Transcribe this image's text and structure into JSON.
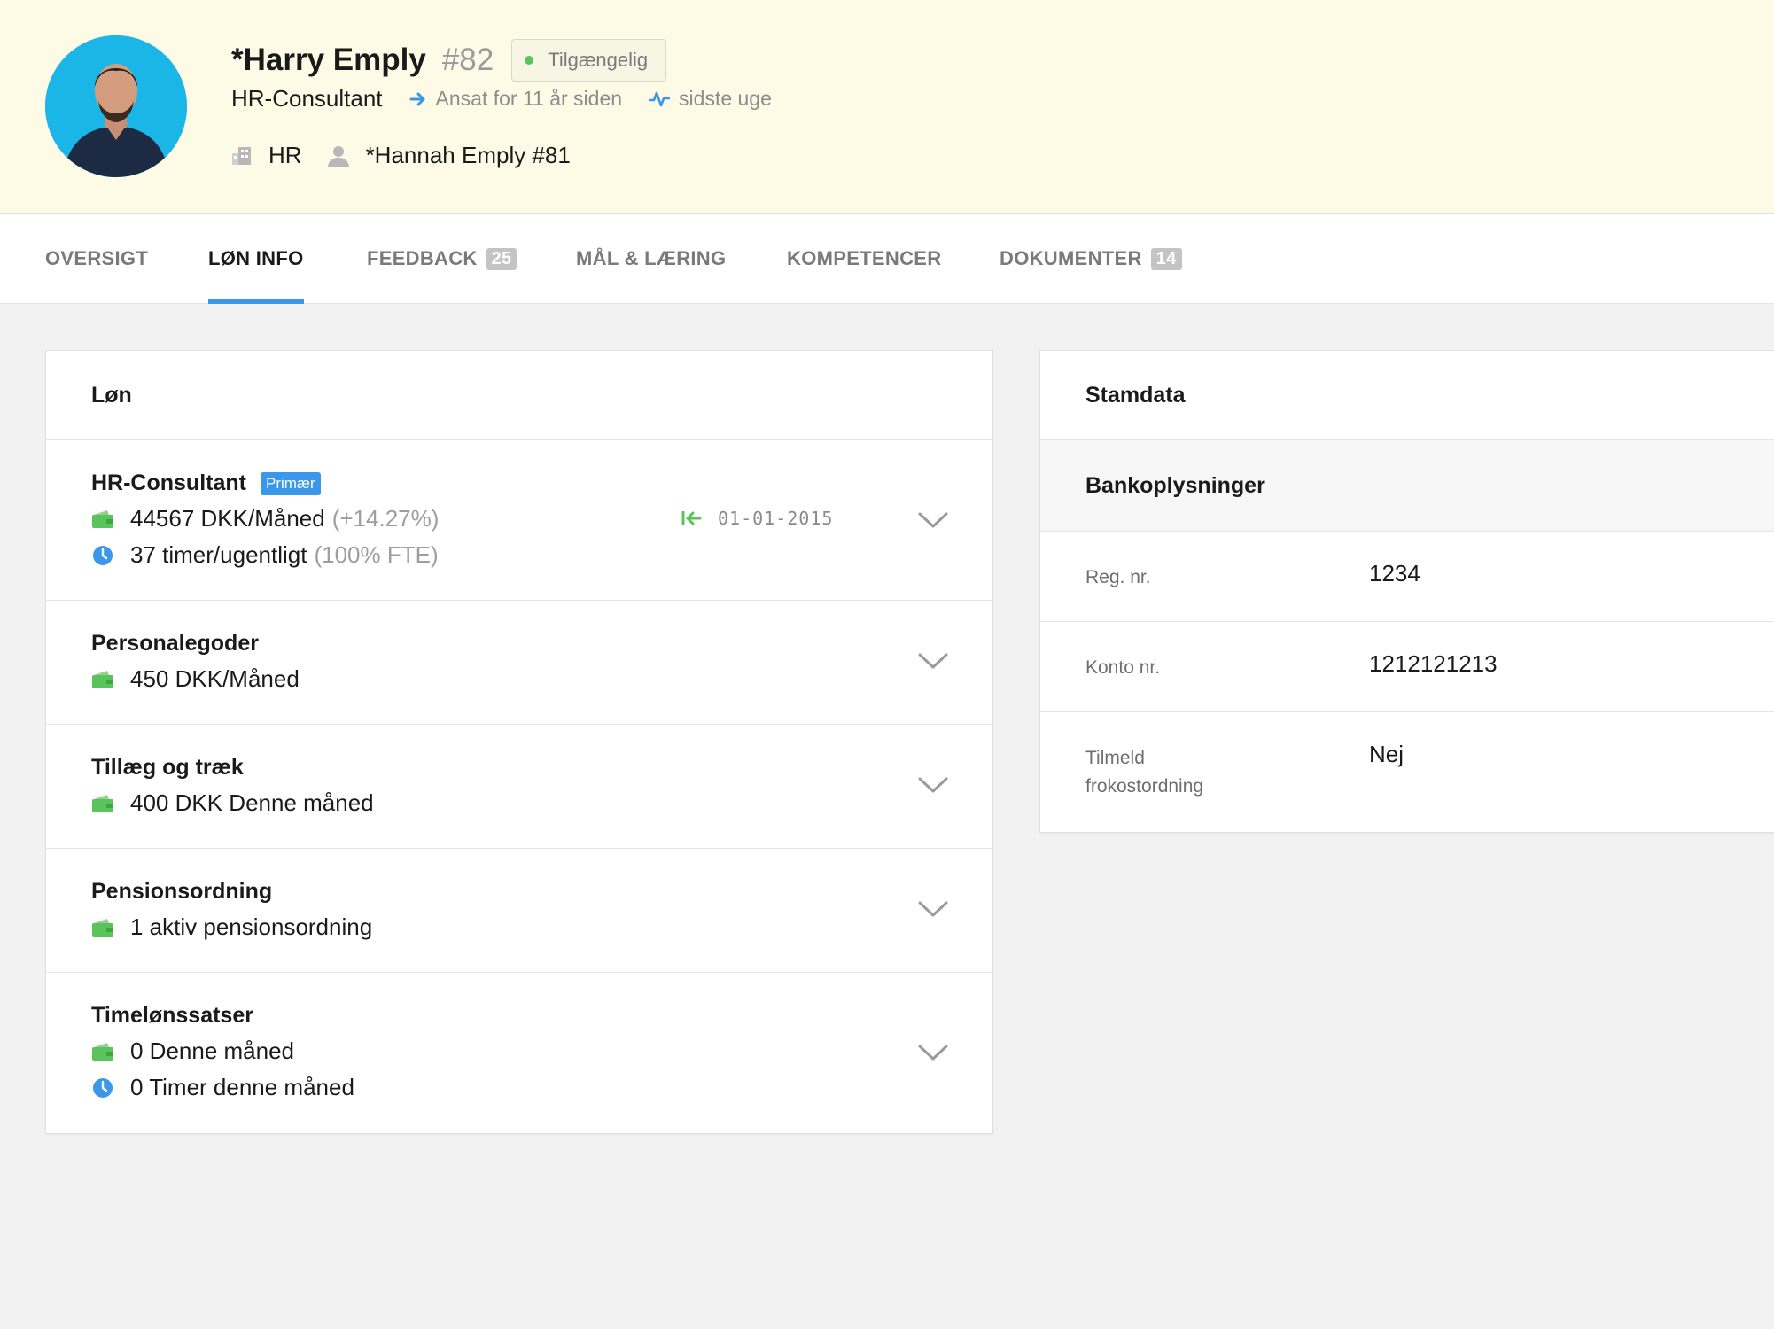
{
  "profile": {
    "name": "*Harry Emply",
    "id": "#82",
    "status": "Tilgængelig",
    "role": "HR-Consultant",
    "employed": "Ansat for 11 år siden",
    "activity": "sidste uge",
    "department": "HR",
    "manager": "*Hannah Emply #81"
  },
  "tabs": [
    {
      "label": "OVERSIGT"
    },
    {
      "label": "LØN INFO",
      "active": true
    },
    {
      "label": "FEEDBACK",
      "badge": "25"
    },
    {
      "label": "MÅL & LÆRING"
    },
    {
      "label": "KOMPETENCER"
    },
    {
      "label": "DOKUMENTER",
      "badge": "14"
    }
  ],
  "salary_card": {
    "title": "Løn",
    "position": {
      "title": "HR-Consultant",
      "tag": "Primær",
      "salary": "44567 DKK/Måned",
      "salary_change": "(+14.27%)",
      "hours": "37 timer/ugentligt",
      "fte": "(100% FTE)",
      "date": "01-01-2015"
    },
    "benefits": {
      "title": "Personalegoder",
      "value": "450 DKK/Måned"
    },
    "supplements": {
      "title": "Tillæg og træk",
      "value": "400 DKK Denne måned"
    },
    "pension": {
      "title": "Pensionsordning",
      "value": "1 aktiv pensionsordning"
    },
    "hourly": {
      "title": "Timelønssatser",
      "value": "0 Denne måned",
      "hours": "0 Timer denne måned"
    }
  },
  "master_card": {
    "title": "Stamdata",
    "bank_title": "Bankoplysninger",
    "rows": [
      {
        "label": "Reg. nr.",
        "value": "1234"
      },
      {
        "label": "Konto nr.",
        "value": "1212121213"
      },
      {
        "label": "Tilmeld frokostordning",
        "value": "Nej"
      }
    ]
  },
  "colors": {
    "header_bg": "#fdfbe6",
    "accent": "#3a97ea",
    "wallet_green": "#5bc35b",
    "status_green": "#5bc35b"
  },
  "icons": {
    "salary": "wallet-icon",
    "hours": "clock-icon",
    "expand": "chevron-down-icon",
    "start_date": "arrow-to-start-icon",
    "employed": "arrow-right-icon",
    "activity": "pulse-icon",
    "department": "building-icon",
    "manager": "person-icon"
  }
}
